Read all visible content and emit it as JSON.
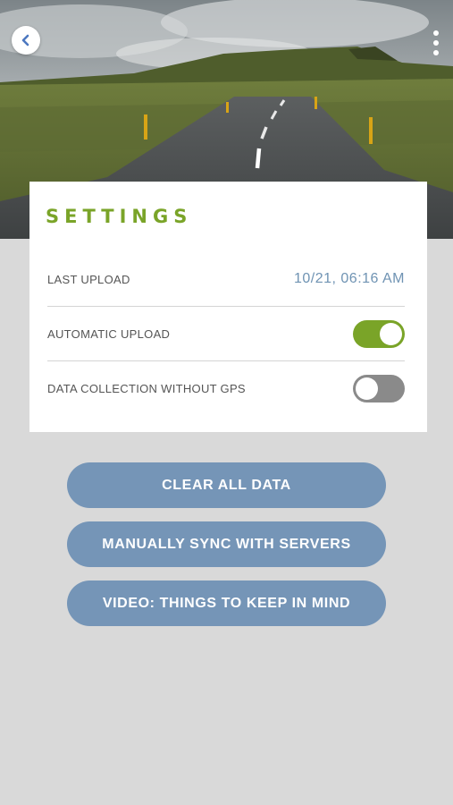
{
  "header": {
    "back_icon": "chevron-left-icon",
    "menu_icon": "more-vertical-icon"
  },
  "settings": {
    "title": "SETTINGS",
    "last_upload": {
      "label": "LAST UPLOAD",
      "value": "10/21, 06:16 AM"
    },
    "automatic_upload": {
      "label": "AUTOMATIC UPLOAD",
      "enabled": true
    },
    "data_collection_without_gps": {
      "label": "DATA COLLECTION WITHOUT GPS",
      "enabled": false
    }
  },
  "actions": {
    "clear_all": "CLEAR ALL DATA",
    "manual_sync": "MANUALLY SYNC WITH SERVERS",
    "video": "VIDEO: THINGS TO KEEP IN MIND"
  },
  "colors": {
    "accent_green": "#7aa428",
    "button_blue": "#7595b7",
    "value_blue": "#6f93b3",
    "background": "#d9d9d9"
  }
}
